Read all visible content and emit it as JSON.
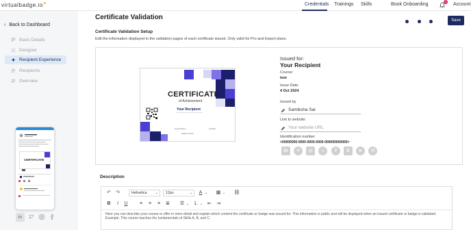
{
  "app": {
    "logo_text": "virtualbadge.io",
    "nav": {
      "credentials": "Credentials",
      "trainings": "Trainings",
      "skills": "Skills",
      "book_onboarding": "Book Onboarding",
      "account": "Account"
    },
    "notification_count": "1"
  },
  "sidebar": {
    "back_label": "Back to Dashboard",
    "items": [
      {
        "label": "Basic Details",
        "icon": "flag-icon"
      },
      {
        "label": "Designer",
        "icon": "designer-icon"
      },
      {
        "label": "Recipient Experience",
        "icon": "sparkle-icon"
      },
      {
        "label": "Recipients",
        "icon": "users-icon"
      },
      {
        "label": "Overview",
        "icon": "list-icon"
      }
    ],
    "phone_cert_title": "CERTIFICATE"
  },
  "main": {
    "title": "Certificate Validation",
    "save_label": "Save",
    "section_title": "Certificate Validation Setup",
    "section_desc": "Edit the information displayed in the validation pages of each certificate issued. Only valid for Pro and Expert plans.",
    "steps": 3
  },
  "certificate": {
    "title": "CERTIFICATE",
    "subtitle": "of Achievement",
    "recipient": "Your Recipient",
    "footer_left": "presentation",
    "footer_right": "position",
    "footer_sign": "Kassie Smith"
  },
  "details": {
    "issued_for_label": "Issued for:",
    "recipient": "Your Recipient",
    "course_label": "Course:",
    "course_value": "test",
    "issue_date_label": "Issue Date:",
    "issue_date_value": "4 Oct 2024",
    "issued_by_label": "Issued by",
    "issued_by_value": "Samiksha Sai",
    "website_label": "Link to website:",
    "website_placeholder": "Your website URL",
    "id_label": "Identification number",
    "id_value": "<00000000-0000-0000-0000-000000000000>",
    "socials": [
      "linkedin-icon",
      "xing-icon",
      "instagram-icon",
      "snapchat-icon",
      "facebook-icon",
      "x-icon",
      "telegram-icon",
      "share-icon"
    ]
  },
  "description": {
    "title": "Description",
    "font_family": "Helvetica",
    "font_size": "12px",
    "body": "Here you can describe your course or offer in more detail and explain which content the certificate or badge was issued for. This information is public and will be displayed when an issued certificate or badge is validated. Example: This course teaches the fundamentals of Skills A, B, and C."
  },
  "colors": {
    "brand": "#1c2a5e",
    "accent": "#f2c230",
    "sidebar_active_bg": "#dde9f7",
    "cert_purple": "#4b3fd1"
  }
}
